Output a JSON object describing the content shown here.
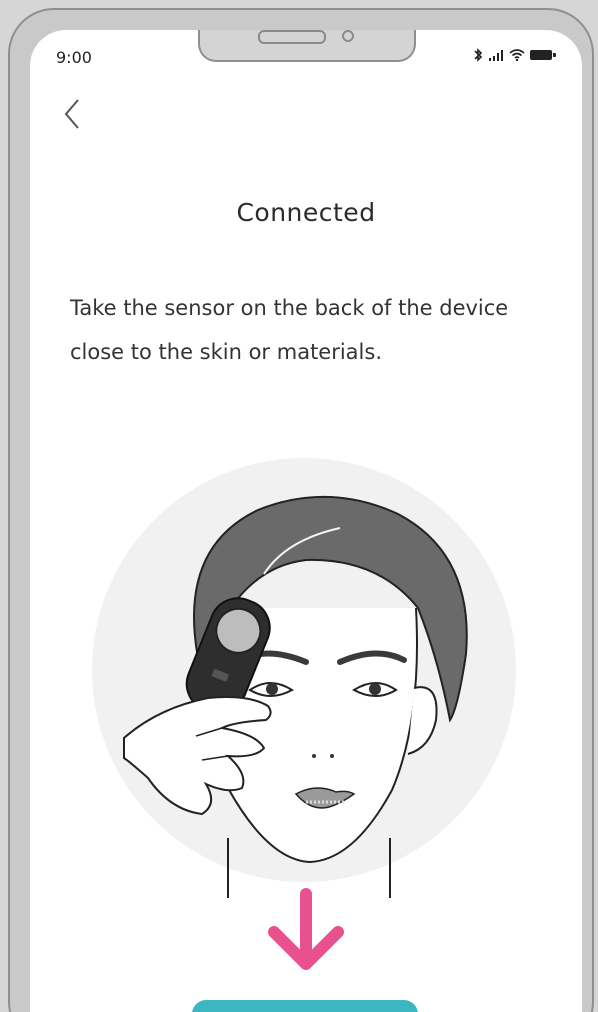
{
  "status_bar": {
    "time": "9:00",
    "bluetooth_icon": "bluetooth-icon",
    "signal_icon": "signal-icon",
    "wifi_icon": "wifi-icon",
    "battery_icon": "battery-icon"
  },
  "header": {
    "back_icon": "chevron-left-icon"
  },
  "main": {
    "title": "Connected",
    "instruction": "Take the sensor on the back of the device close to the skin or materials."
  },
  "colors": {
    "accent_arrow": "#e8518e",
    "button": "#3eb6c2"
  }
}
